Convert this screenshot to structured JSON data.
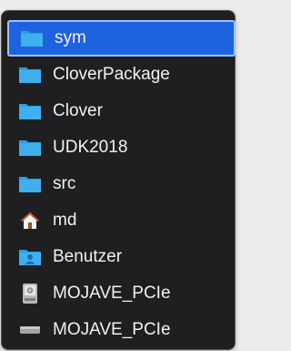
{
  "colors": {
    "menu_background": "#1f1f21",
    "selection": "#1d63e0",
    "folder": "#2d9fe0",
    "text": "#f2f2f2"
  },
  "menu": {
    "items": [
      {
        "label": "sym",
        "icon": "folder-icon",
        "selected": true
      },
      {
        "label": "CloverPackage",
        "icon": "folder-icon",
        "selected": false
      },
      {
        "label": "Clover",
        "icon": "folder-icon",
        "selected": false
      },
      {
        "label": "UDK2018",
        "icon": "folder-icon",
        "selected": false
      },
      {
        "label": "src",
        "icon": "folder-icon",
        "selected": false
      },
      {
        "label": "md",
        "icon": "home-icon",
        "selected": false
      },
      {
        "label": "Benutzer",
        "icon": "users-folder-icon",
        "selected": false
      },
      {
        "label": "MOJAVE_PCIe",
        "icon": "internal-disk-icon",
        "selected": false
      },
      {
        "label": "MOJAVE_PCIe",
        "icon": "external-drive-icon",
        "selected": false
      }
    ]
  }
}
